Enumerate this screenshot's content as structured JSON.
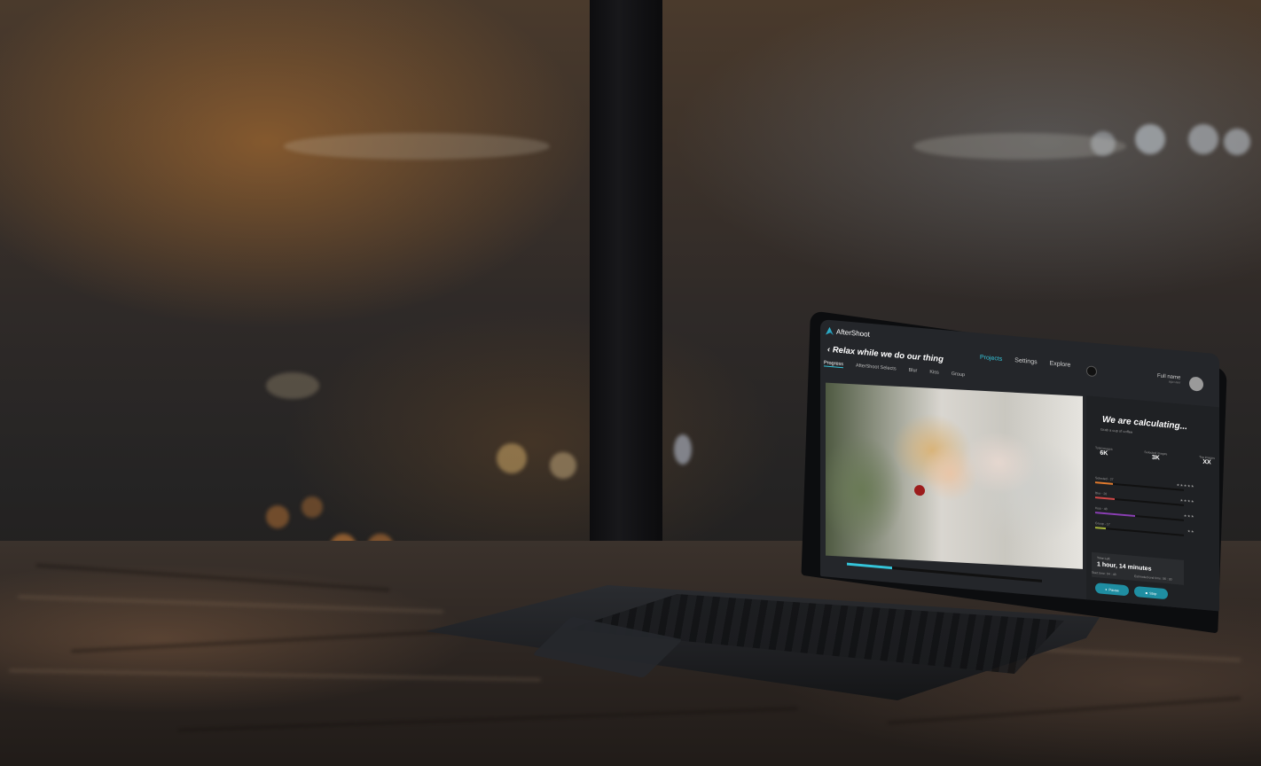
{
  "app": {
    "name": "AfterShoot",
    "nav": [
      "Projects",
      "Settings",
      "Explore"
    ],
    "user": {
      "name": "Full name",
      "sub": "ago user"
    },
    "title": "Relax while we do our thing",
    "tabs": [
      "Progress",
      "AfterShoot Selects",
      "Blur",
      "Kiss",
      "Group"
    ],
    "status": {
      "heading": "We are calculating...",
      "subheading": "Grab a cup of coffee"
    },
    "stats": [
      {
        "label": "Total images",
        "value": "6K"
      },
      {
        "label": "Selected images",
        "value": "3K"
      },
      {
        "label": "Tag images",
        "value": "XX"
      }
    ],
    "breakdown": [
      {
        "label": "Selected - 27",
        "stars": "★★★★★",
        "color": "#e07a2e",
        "fraction": 0.2
      },
      {
        "label": "Blur - 20",
        "stars": "★★★★",
        "color": "#d04848",
        "fraction": 0.22
      },
      {
        "label": "Kiss - 48",
        "stars": "★★★",
        "color": "#8a3fb3",
        "fraction": 0.45
      },
      {
        "label": "Group - 17",
        "stars": "★★",
        "color": "#a4b33a",
        "fraction": 0.12
      }
    ],
    "time": {
      "label": "Time Left",
      "value": "1 hour, 14 minutes",
      "started": "Start time: 04 : 48",
      "estimated": "Estimated end time: 06 : 30"
    },
    "buttons": {
      "pause": "Pause",
      "stop": "Stop"
    },
    "progress_fraction": 0.23
  }
}
